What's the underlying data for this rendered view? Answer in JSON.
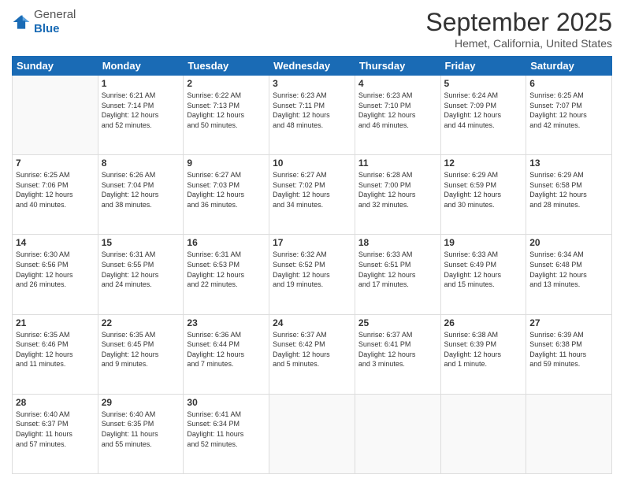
{
  "header": {
    "logo": {
      "general": "General",
      "blue": "Blue"
    },
    "title": "September 2025",
    "subtitle": "Hemet, California, United States"
  },
  "days_of_week": [
    "Sunday",
    "Monday",
    "Tuesday",
    "Wednesday",
    "Thursday",
    "Friday",
    "Saturday"
  ],
  "weeks": [
    [
      {
        "day": "",
        "info": ""
      },
      {
        "day": "1",
        "info": "Sunrise: 6:21 AM\nSunset: 7:14 PM\nDaylight: 12 hours\nand 52 minutes."
      },
      {
        "day": "2",
        "info": "Sunrise: 6:22 AM\nSunset: 7:13 PM\nDaylight: 12 hours\nand 50 minutes."
      },
      {
        "day": "3",
        "info": "Sunrise: 6:23 AM\nSunset: 7:11 PM\nDaylight: 12 hours\nand 48 minutes."
      },
      {
        "day": "4",
        "info": "Sunrise: 6:23 AM\nSunset: 7:10 PM\nDaylight: 12 hours\nand 46 minutes."
      },
      {
        "day": "5",
        "info": "Sunrise: 6:24 AM\nSunset: 7:09 PM\nDaylight: 12 hours\nand 44 minutes."
      },
      {
        "day": "6",
        "info": "Sunrise: 6:25 AM\nSunset: 7:07 PM\nDaylight: 12 hours\nand 42 minutes."
      }
    ],
    [
      {
        "day": "7",
        "info": "Sunrise: 6:25 AM\nSunset: 7:06 PM\nDaylight: 12 hours\nand 40 minutes."
      },
      {
        "day": "8",
        "info": "Sunrise: 6:26 AM\nSunset: 7:04 PM\nDaylight: 12 hours\nand 38 minutes."
      },
      {
        "day": "9",
        "info": "Sunrise: 6:27 AM\nSunset: 7:03 PM\nDaylight: 12 hours\nand 36 minutes."
      },
      {
        "day": "10",
        "info": "Sunrise: 6:27 AM\nSunset: 7:02 PM\nDaylight: 12 hours\nand 34 minutes."
      },
      {
        "day": "11",
        "info": "Sunrise: 6:28 AM\nSunset: 7:00 PM\nDaylight: 12 hours\nand 32 minutes."
      },
      {
        "day": "12",
        "info": "Sunrise: 6:29 AM\nSunset: 6:59 PM\nDaylight: 12 hours\nand 30 minutes."
      },
      {
        "day": "13",
        "info": "Sunrise: 6:29 AM\nSunset: 6:58 PM\nDaylight: 12 hours\nand 28 minutes."
      }
    ],
    [
      {
        "day": "14",
        "info": "Sunrise: 6:30 AM\nSunset: 6:56 PM\nDaylight: 12 hours\nand 26 minutes."
      },
      {
        "day": "15",
        "info": "Sunrise: 6:31 AM\nSunset: 6:55 PM\nDaylight: 12 hours\nand 24 minutes."
      },
      {
        "day": "16",
        "info": "Sunrise: 6:31 AM\nSunset: 6:53 PM\nDaylight: 12 hours\nand 22 minutes."
      },
      {
        "day": "17",
        "info": "Sunrise: 6:32 AM\nSunset: 6:52 PM\nDaylight: 12 hours\nand 19 minutes."
      },
      {
        "day": "18",
        "info": "Sunrise: 6:33 AM\nSunset: 6:51 PM\nDaylight: 12 hours\nand 17 minutes."
      },
      {
        "day": "19",
        "info": "Sunrise: 6:33 AM\nSunset: 6:49 PM\nDaylight: 12 hours\nand 15 minutes."
      },
      {
        "day": "20",
        "info": "Sunrise: 6:34 AM\nSunset: 6:48 PM\nDaylight: 12 hours\nand 13 minutes."
      }
    ],
    [
      {
        "day": "21",
        "info": "Sunrise: 6:35 AM\nSunset: 6:46 PM\nDaylight: 12 hours\nand 11 minutes."
      },
      {
        "day": "22",
        "info": "Sunrise: 6:35 AM\nSunset: 6:45 PM\nDaylight: 12 hours\nand 9 minutes."
      },
      {
        "day": "23",
        "info": "Sunrise: 6:36 AM\nSunset: 6:44 PM\nDaylight: 12 hours\nand 7 minutes."
      },
      {
        "day": "24",
        "info": "Sunrise: 6:37 AM\nSunset: 6:42 PM\nDaylight: 12 hours\nand 5 minutes."
      },
      {
        "day": "25",
        "info": "Sunrise: 6:37 AM\nSunset: 6:41 PM\nDaylight: 12 hours\nand 3 minutes."
      },
      {
        "day": "26",
        "info": "Sunrise: 6:38 AM\nSunset: 6:39 PM\nDaylight: 12 hours\nand 1 minute."
      },
      {
        "day": "27",
        "info": "Sunrise: 6:39 AM\nSunset: 6:38 PM\nDaylight: 11 hours\nand 59 minutes."
      }
    ],
    [
      {
        "day": "28",
        "info": "Sunrise: 6:40 AM\nSunset: 6:37 PM\nDaylight: 11 hours\nand 57 minutes."
      },
      {
        "day": "29",
        "info": "Sunrise: 6:40 AM\nSunset: 6:35 PM\nDaylight: 11 hours\nand 55 minutes."
      },
      {
        "day": "30",
        "info": "Sunrise: 6:41 AM\nSunset: 6:34 PM\nDaylight: 11 hours\nand 52 minutes."
      },
      {
        "day": "",
        "info": ""
      },
      {
        "day": "",
        "info": ""
      },
      {
        "day": "",
        "info": ""
      },
      {
        "day": "",
        "info": ""
      }
    ]
  ]
}
